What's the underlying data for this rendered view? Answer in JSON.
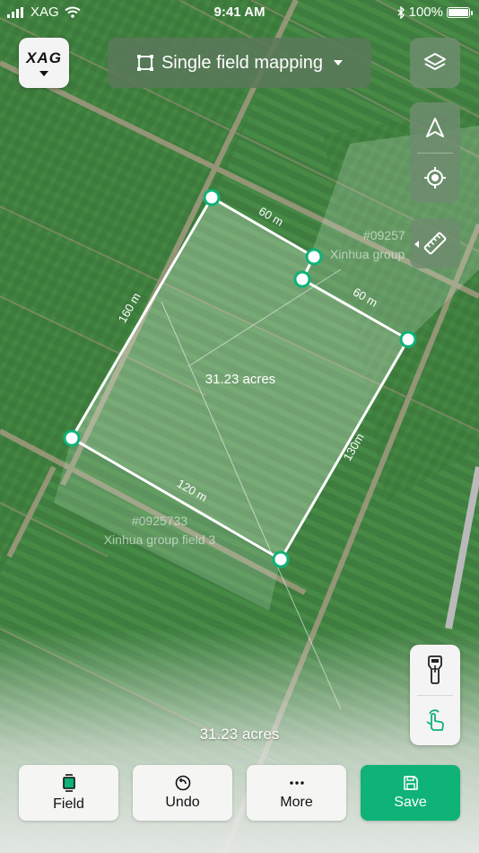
{
  "status_bar": {
    "carrier": "XAG",
    "time": "9:41 AM",
    "battery": "100%"
  },
  "header": {
    "logo_text": "XAG",
    "mode_label": "Single field mapping"
  },
  "map": {
    "selected_field_area": "31.23 acres",
    "edge_labels": [
      "60 m",
      "60 m",
      "160 m",
      "130m",
      "120 m"
    ],
    "neighbor_field_1": {
      "id": "#0925733",
      "name": "Xinhua group field 3"
    },
    "neighbor_field_2": {
      "id": "#09257",
      "name": "Xinhua group"
    }
  },
  "summary": {
    "area": "31.23 acres"
  },
  "toolbar": {
    "field_label": "Field",
    "undo_label": "Undo",
    "more_label": "More",
    "save_label": "Save"
  },
  "colors": {
    "accent": "#0fb277",
    "boundary": "#ffffff",
    "vertex_fill": "#0fb277"
  },
  "icons": {
    "layers": "layers-icon",
    "navigate": "navigation-arrow-icon",
    "locate": "locate-target-icon",
    "ruler": "ruler-icon",
    "rtk": "rtk-device-icon",
    "tap": "tap-hand-icon"
  }
}
